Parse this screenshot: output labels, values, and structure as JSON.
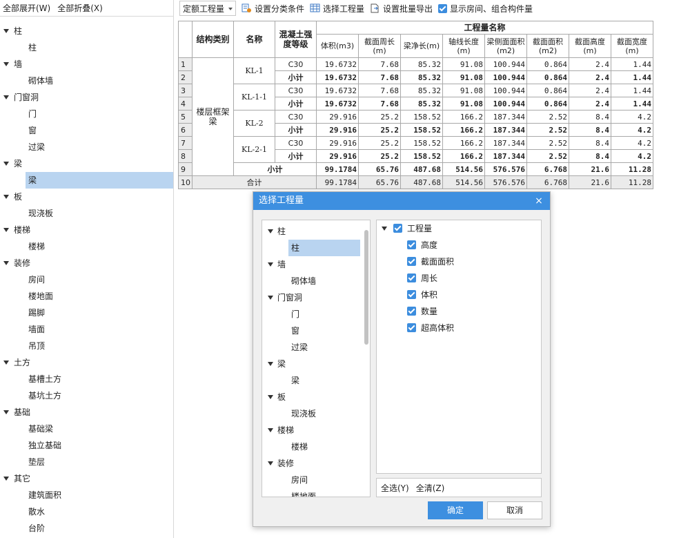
{
  "left": {
    "expand_all": "全部展开(W)",
    "collapse_all": "全部折叠(X)",
    "items": [
      {
        "label": "柱",
        "level": 0
      },
      {
        "label": "柱",
        "level": 1
      },
      {
        "label": "墙",
        "level": 0
      },
      {
        "label": "砌体墙",
        "level": 1
      },
      {
        "label": "门窗洞",
        "level": 0
      },
      {
        "label": "门",
        "level": 1
      },
      {
        "label": "窗",
        "level": 1
      },
      {
        "label": "过梁",
        "level": 1
      },
      {
        "label": "梁",
        "level": 0
      },
      {
        "label": "梁",
        "level": 1,
        "selected": true
      },
      {
        "label": "板",
        "level": 0
      },
      {
        "label": "现浇板",
        "level": 1
      },
      {
        "label": "楼梯",
        "level": 0
      },
      {
        "label": "楼梯",
        "level": 1
      },
      {
        "label": "装修",
        "level": 0
      },
      {
        "label": "房间",
        "level": 1
      },
      {
        "label": "楼地面",
        "level": 1
      },
      {
        "label": "踢脚",
        "level": 1
      },
      {
        "label": "墙面",
        "level": 1
      },
      {
        "label": "吊顶",
        "level": 1
      },
      {
        "label": "土方",
        "level": 0
      },
      {
        "label": "基槽土方",
        "level": 1
      },
      {
        "label": "基坑土方",
        "level": 1
      },
      {
        "label": "基础",
        "level": 0
      },
      {
        "label": "基础梁",
        "level": 1
      },
      {
        "label": "独立基础",
        "level": 1
      },
      {
        "label": "垫层",
        "level": 1
      },
      {
        "label": "其它",
        "level": 0
      },
      {
        "label": "建筑面积",
        "level": 1
      },
      {
        "label": "散水",
        "level": 1
      },
      {
        "label": "台阶",
        "level": 1
      }
    ]
  },
  "toolbar": {
    "combo": "定额工程量",
    "set_category": "设置分类条件",
    "select_quantity": "选择工程量",
    "set_batch_export": "设置批量导出",
    "show_room": "显示房间、组合构件量"
  },
  "table": {
    "h_struct": "结构类别",
    "h_name": "名称",
    "h_grade": "混凝土强度等级",
    "h_group": "工程量名称",
    "cols": [
      "体积(m3)",
      "截面周长(m)",
      "梁净长(m)",
      "轴线长度(m)",
      "梁侧面面积(m2)",
      "截面面积(m2)",
      "截面高度(m)",
      "截面宽度(m)"
    ],
    "struct_value": "楼层框架梁",
    "groups": [
      {
        "name": "KL-1",
        "grade": "C30",
        "sub": "小计",
        "vals": [
          "19.6732",
          "7.68",
          "85.32",
          "91.08",
          "100.944",
          "0.864",
          "2.4",
          "1.44"
        ]
      },
      {
        "name": "KL-1-1",
        "grade": "C30",
        "sub": "小计",
        "vals": [
          "19.6732",
          "7.68",
          "85.32",
          "91.08",
          "100.944",
          "0.864",
          "2.4",
          "1.44"
        ]
      },
      {
        "name": "KL-2",
        "grade": "C30",
        "sub": "小计",
        "vals": [
          "29.916",
          "25.2",
          "158.52",
          "166.2",
          "187.344",
          "2.52",
          "8.4",
          "4.2"
        ]
      },
      {
        "name": "KL-2-1",
        "grade": "C30",
        "sub": "小计",
        "vals": [
          "29.916",
          "25.2",
          "158.52",
          "166.2",
          "187.344",
          "2.52",
          "8.4",
          "4.2"
        ]
      }
    ],
    "subtotal_label": "小计",
    "subtotal": [
      "99.1784",
      "65.76",
      "487.68",
      "514.56",
      "576.576",
      "6.768",
      "21.6",
      "11.28"
    ],
    "total_label": "合计",
    "total": [
      "99.1784",
      "65.76",
      "487.68",
      "514.56",
      "576.576",
      "6.768",
      "21.6",
      "11.28"
    ]
  },
  "dialog": {
    "title": "选择工程量",
    "close": "×",
    "tree": [
      {
        "label": "柱",
        "level": 0
      },
      {
        "label": "柱",
        "level": 1,
        "selected": true
      },
      {
        "label": "墙",
        "level": 0
      },
      {
        "label": "砌体墙",
        "level": 1
      },
      {
        "label": "门窗洞",
        "level": 0
      },
      {
        "label": "门",
        "level": 1
      },
      {
        "label": "窗",
        "level": 1
      },
      {
        "label": "过梁",
        "level": 1
      },
      {
        "label": "梁",
        "level": 0
      },
      {
        "label": "梁",
        "level": 1
      },
      {
        "label": "板",
        "level": 0
      },
      {
        "label": "现浇板",
        "level": 1
      },
      {
        "label": "楼梯",
        "level": 0
      },
      {
        "label": "楼梯",
        "level": 1
      },
      {
        "label": "装修",
        "level": 0
      },
      {
        "label": "房间",
        "level": 1
      },
      {
        "label": "楼地面",
        "level": 1
      }
    ],
    "checklist": {
      "root": "工程量",
      "items": [
        "高度",
        "截面面积",
        "周长",
        "体积",
        "数量",
        "超高体积"
      ]
    },
    "select_all": "全选(Y)",
    "clear_all": "全清(Z)",
    "ok": "确定",
    "cancel": "取消"
  }
}
